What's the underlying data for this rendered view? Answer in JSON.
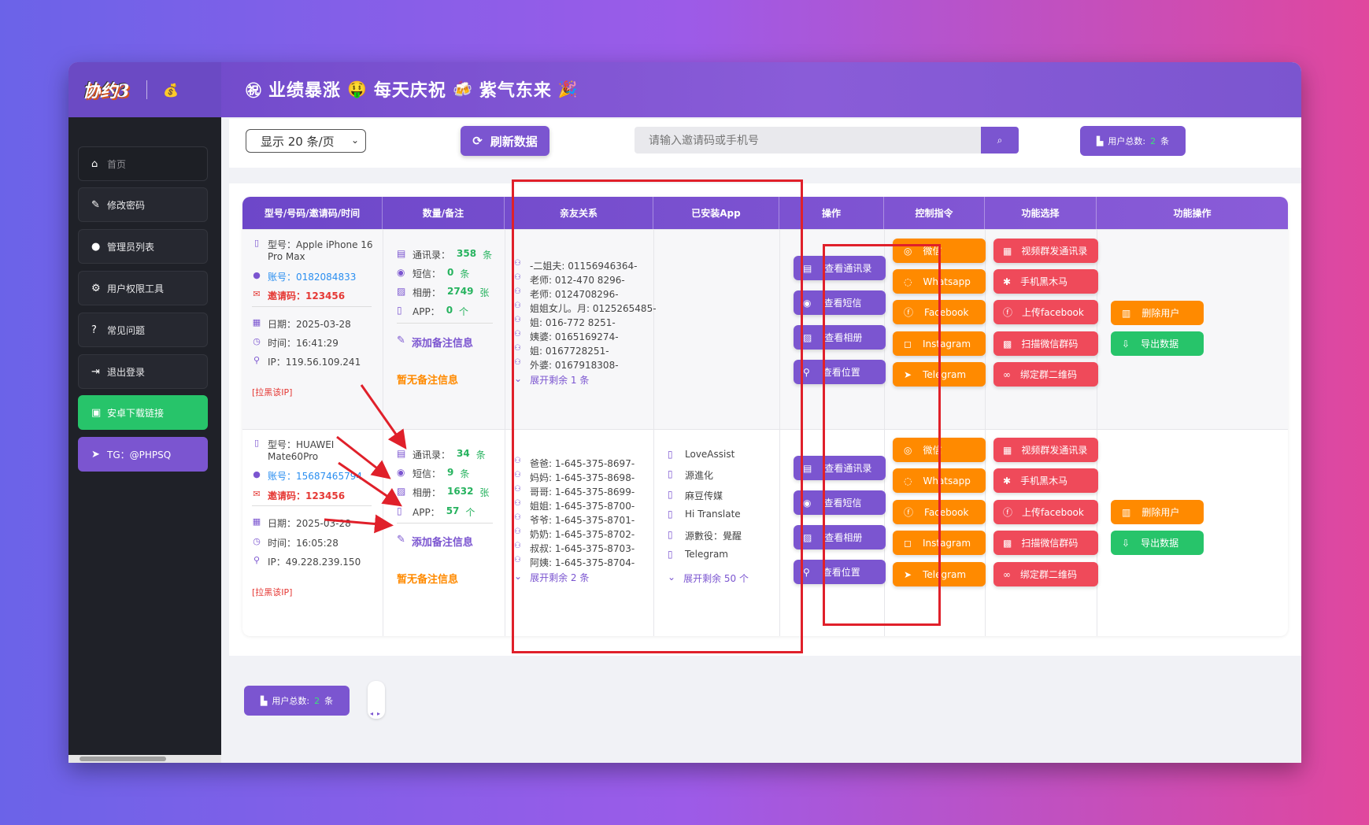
{
  "brand": {
    "logo": "协约3",
    "money_icon": "money-bag-icon"
  },
  "marquee": {
    "t1": "业绩暴涨",
    "t2": "每天庆祝",
    "t3": "紫气东来"
  },
  "sidebar": {
    "items": [
      {
        "label": "首页",
        "icon": "home-icon"
      },
      {
        "label": "修改密码",
        "icon": "user-edit-icon"
      },
      {
        "label": "管理员列表",
        "icon": "users-icon"
      },
      {
        "label": "用户权限工具",
        "icon": "user-gear-icon"
      },
      {
        "label": "常见问题",
        "icon": "question-icon"
      },
      {
        "label": "退出登录",
        "icon": "logout-icon"
      },
      {
        "label": "安卓下载链接",
        "icon": "android-icon"
      },
      {
        "label": "TG：@PHPSQ",
        "icon": "telegram-icon"
      }
    ]
  },
  "toolbar": {
    "page_size": "显示 20 条/页",
    "refresh": "刷新数据",
    "search_placeholder": "请输入邀请码或手机号",
    "total_label": "用户总数:",
    "total_value": "2",
    "total_unit": "条"
  },
  "table": {
    "headers": [
      "型号/号码/邀请码/时间",
      "数量/备注",
      "亲友关系",
      "已安装App",
      "操作",
      "控制指令",
      "功能选择",
      "功能操作"
    ]
  },
  "rows": [
    {
      "model": "型号：Apple iPhone 16 Pro Max",
      "model_l1": "型号：Apple iPhone 16",
      "model_l2": "Pro Max",
      "account": "账号：0182084833",
      "invite": "邀请码：123456",
      "date": "日期：2025-03-28",
      "time": "时间：16:41:29",
      "ip": "IP：119.56.109.241",
      "blacklist": "[拉黑该IP]",
      "stats": [
        {
          "label": "通讯录：",
          "value": "358",
          "unit": "条"
        },
        {
          "label": "短信：",
          "value": "0",
          "unit": "条"
        },
        {
          "label": "相册：",
          "value": "2749",
          "unit": "张"
        },
        {
          "label": "APP：",
          "value": "0",
          "unit": "个"
        }
      ],
      "add_note": "添加备注信息",
      "no_note": "暂无备注信息",
      "contacts": [
        "-二姐夫: 01156946364-",
        "老师: 012-470 8296-",
        "老师: 0124708296-",
        "姐姐女儿。月: 0125265485-",
        "姐: 016-772 8251-",
        "姨婆: 0165169274-",
        "姐: 0167728251-",
        "外婆: 0167918308-"
      ],
      "contacts_more": "展开剩余 1 条",
      "apps": [],
      "apps_more": ""
    },
    {
      "model_l1": "型号：HUAWEI",
      "model_l2": "Mate60Pro",
      "account": "账号：15687465794",
      "invite": "邀请码：123456",
      "date": "日期：2025-03-28",
      "time": "时间：16:05:28",
      "ip": "IP：49.228.239.150",
      "blacklist": "[拉黑该IP]",
      "stats": [
        {
          "label": "通讯录：",
          "value": "34",
          "unit": "条"
        },
        {
          "label": "短信：",
          "value": "9",
          "unit": "条"
        },
        {
          "label": "相册：",
          "value": "1632",
          "unit": "张"
        },
        {
          "label": "APP：",
          "value": "57",
          "unit": "个"
        }
      ],
      "add_note": "添加备注信息",
      "no_note": "暂无备注信息",
      "contacts": [
        "爸爸: 1-645-375-8697-",
        "妈妈: 1-645-375-8698-",
        "哥哥: 1-645-375-8699-",
        "姐姐: 1-645-375-8700-",
        "爷爷: 1-645-375-8701-",
        "奶奶: 1-645-375-8702-",
        "叔叔: 1-645-375-8703-",
        "阿姨: 1-645-375-8704-"
      ],
      "contacts_more": "展开剩余 2 条",
      "apps": [
        "LoveAssist",
        "源進化",
        "麻豆传媒",
        "Hi Translate",
        "源數役：覺醒",
        "Telegram"
      ],
      "apps_more": "展开剩余 50 个"
    }
  ],
  "actions": [
    "查看通讯录",
    "查看短信",
    "查看相册",
    "查看位置"
  ],
  "commands": [
    "微信",
    "Whatsapp",
    "Facebook",
    "Instagram",
    "Telegram"
  ],
  "functions": [
    "视频群发通讯录",
    "手机黑木马",
    "上传facebook",
    "扫描微信群码",
    "绑定群二维码"
  ],
  "ops": {
    "delete": "删除用户",
    "export": "导出数据"
  },
  "footer": {
    "total_label": "用户总数:",
    "total_value": "2",
    "total_unit": "条"
  },
  "colors": {
    "accent": "#7b55d0",
    "orange": "#ff8a00",
    "red": "#ef4a5a",
    "green": "#27c46a"
  }
}
